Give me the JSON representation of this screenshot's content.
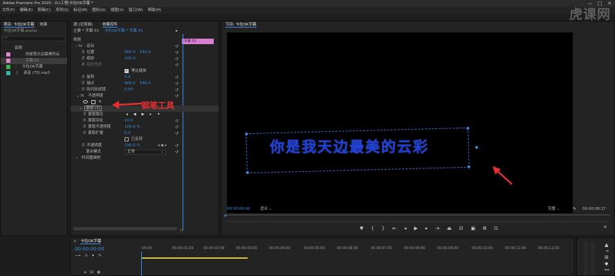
{
  "window": {
    "title": "Adobe Premiere Pro 2020 - D:\\工程\\卡拉OK字幕 *",
    "minimize": "—",
    "maximize": "□",
    "close": "✕"
  },
  "menu": [
    "文件(F)",
    "编辑(E)",
    "剪辑(C)",
    "序列(S)",
    "标记(M)",
    "图形(G)",
    "视图(V)",
    "窗口(W)",
    "帮助(H)"
  ],
  "watermark": "虎课网",
  "project_panel": {
    "tabs": [
      "项目: 卡拉OK字幕",
      "效果"
    ],
    "path": "卡拉OK字幕.prproj",
    "search_placeholder": "",
    "column_name": "名称",
    "items": [
      {
        "label": "你是我天边最美的云",
        "color": "#e08ad1"
      },
      {
        "label": "字幕 01",
        "color": "#e08ad1"
      },
      {
        "label": "卡拉OK字幕",
        "color": "#3fb34f"
      },
      {
        "label": "录音 (75).mp3",
        "color": "#2fb8a6"
      }
    ]
  },
  "effect_controls": {
    "tabs": [
      "源:(无剪辑)",
      "效果控件"
    ],
    "master": "主要 * 字幕 01",
    "clip": "卡拉OK字幕 * 字幕 01",
    "timeline_clip": "字幕 01",
    "section_video": "视频",
    "motion": "运动",
    "position_label": "位置",
    "position_x": "960.0",
    "position_y": "540.0",
    "scale_label": "缩放",
    "scale": "100.0",
    "scale_width_label": "缩放宽度",
    "uniform_scale": "等比缩放",
    "rotation_label": "旋转",
    "rotation": "0.0",
    "anchor_label": "锚点",
    "anchor_x": "960.0",
    "anchor_y": "540.0",
    "flicker_label": "防闪烁滤镜",
    "flicker": "0.00",
    "opacity_section": "不透明度",
    "mask_label": "蒙版 (1)",
    "mask_path": "蒙版路径",
    "mask_feather": "蒙版羽化",
    "mask_feather_value": "10.0",
    "mask_opacity": "蒙版不透明度",
    "mask_opacity_value": "100.0 %",
    "mask_expansion": "蒙版扩展",
    "mask_expansion_value": "0.0",
    "inverted": "已反转",
    "opacity_label": "不透明度",
    "opacity_value": "100.0 %",
    "blend_label": "混合模式",
    "blend_value": "正常",
    "time_remap": "时间重映射",
    "annotation": "钢笔工具"
  },
  "program_monitor": {
    "title": "节目: 卡拉OK字幕",
    "subtitle": "你是我天边最美的云彩",
    "timecode": "00:00:00:00",
    "fit": "适合",
    "quality": "完整",
    "duration": "00:00:08:17"
  },
  "timeline": {
    "tab": "卡拉OK字幕",
    "timecode": "00:00:00:00",
    "ruler": [
      ":00:00",
      "00:00:01:00",
      "00:00:02:00",
      "00:00:03:00",
      "00:00:04:00",
      "00:00:05:00",
      "00:00:06:00",
      "00:00:07:00",
      "00:00:08:00",
      "00:00:09:00",
      "00:00:10:00",
      "00:00:11:00",
      "00:00:12:00"
    ]
  }
}
